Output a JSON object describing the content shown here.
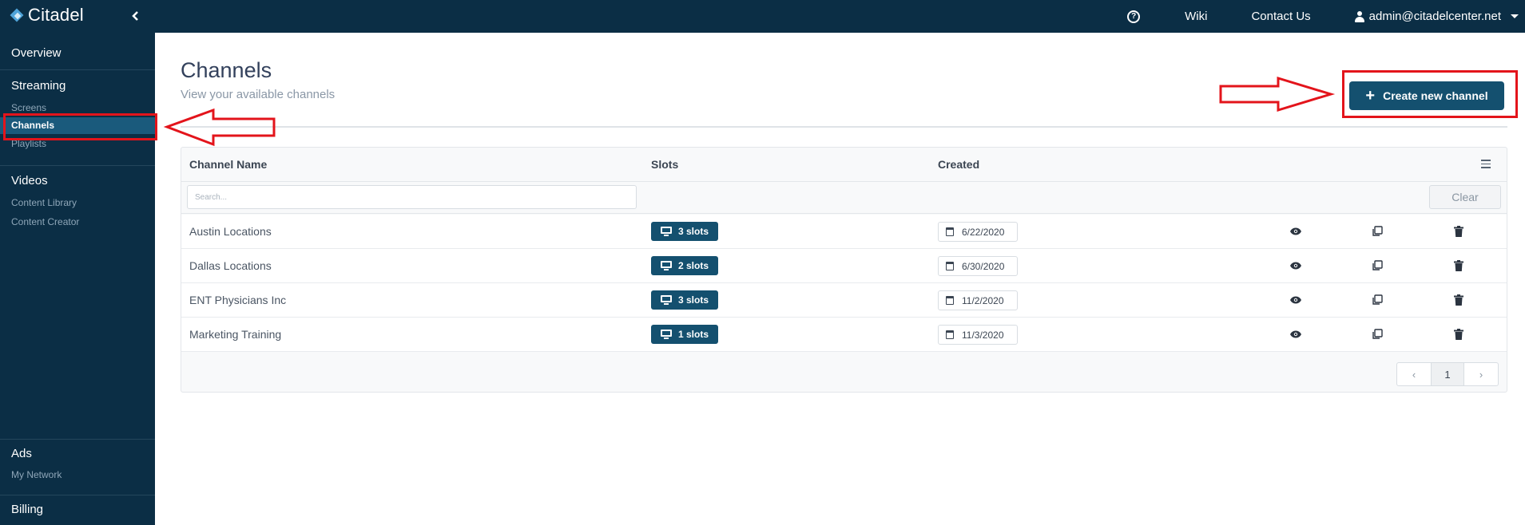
{
  "topbar": {
    "brand": "Citadel",
    "links": [
      "Wiki",
      "Contact Us"
    ],
    "user": "admin@citadelcenter.net"
  },
  "sidebar": {
    "overview": "Overview",
    "streaming": {
      "title": "Streaming",
      "items": [
        "Screens",
        "Channels",
        "Playlists"
      ],
      "active": "Channels"
    },
    "videos": {
      "title": "Videos",
      "items": [
        "Content Library",
        "Content Creator"
      ]
    },
    "ads": {
      "title": "Ads",
      "items": [
        "My Network"
      ]
    },
    "billing": "Billing"
  },
  "page": {
    "title": "Channels",
    "subtitle": "View your available channels",
    "create_button": "Create new channel"
  },
  "table": {
    "columns": [
      "Channel Name",
      "Slots",
      "Created"
    ],
    "search_placeholder": "Search...",
    "clear_label": "Clear",
    "rows": [
      {
        "name": "Austin Locations",
        "slots": "3 slots",
        "created": "6/22/2020"
      },
      {
        "name": "Dallas Locations",
        "slots": "2 slots",
        "created": "6/30/2020"
      },
      {
        "name": "ENT Physicians Inc",
        "slots": "3 slots",
        "created": "11/2/2020"
      },
      {
        "name": "Marketing Training",
        "slots": "1 slots",
        "created": "11/3/2020"
      }
    ],
    "pagination": {
      "current": "1"
    }
  },
  "colors": {
    "nav_bg": "#0b2e45",
    "accent": "#14506f",
    "annotation": "#e3141b"
  }
}
